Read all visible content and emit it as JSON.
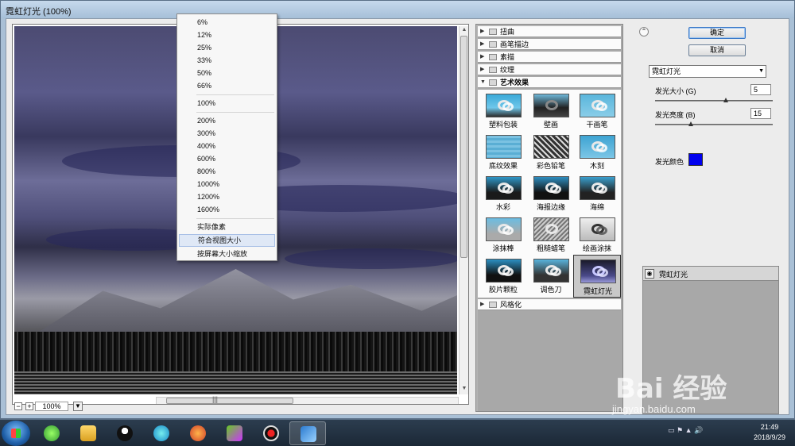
{
  "window": {
    "title": "霓虹灯光 (100%)"
  },
  "zoom": {
    "value": "100%",
    "minus": "−",
    "plus": "+",
    "dropdown": "▼"
  },
  "zoom_menu": {
    "items": [
      "6%",
      "12%",
      "25%",
      "33%",
      "50%",
      "66%",
      "100%",
      "200%",
      "300%",
      "400%",
      "600%",
      "800%",
      "1000%",
      "1200%",
      "1600%",
      "实际像素",
      "符合视图大小",
      "按屏幕大小缩放"
    ],
    "highlighted": "符合视图大小"
  },
  "gallery": {
    "categories_top": [
      "扭曲",
      "画笔描边",
      "素描",
      "纹理"
    ],
    "open_category": "艺术效果",
    "bottom_category": "风格化",
    "thumbnails": [
      "塑料包装",
      "壁画",
      "干画笔",
      "底纹效果",
      "彩色铅笔",
      "木刻",
      "水彩",
      "海报边缘",
      "海绵",
      "涂抹棒",
      "粗糙蜡笔",
      "绘画涂抹",
      "胶片颗粒",
      "调色刀",
      "霓虹灯光"
    ],
    "selected": "霓虹灯光"
  },
  "panel": {
    "ok": "确定",
    "cancel": "取消",
    "filter": "霓虹灯光",
    "glow_size_label": "发光大小 (G)",
    "glow_size_value": "5",
    "glow_brightness_label": "发光亮度 (B)",
    "glow_brightness_value": "15",
    "glow_color_label": "发光颜色",
    "glow_color": "#0000ee",
    "layer_name": "霓虹灯光"
  },
  "watermark": {
    "text": "Bai 经验",
    "url": "jingyan.baidu.com"
  },
  "taskbar": {
    "time": "21:49",
    "date": "2018/9/29"
  }
}
